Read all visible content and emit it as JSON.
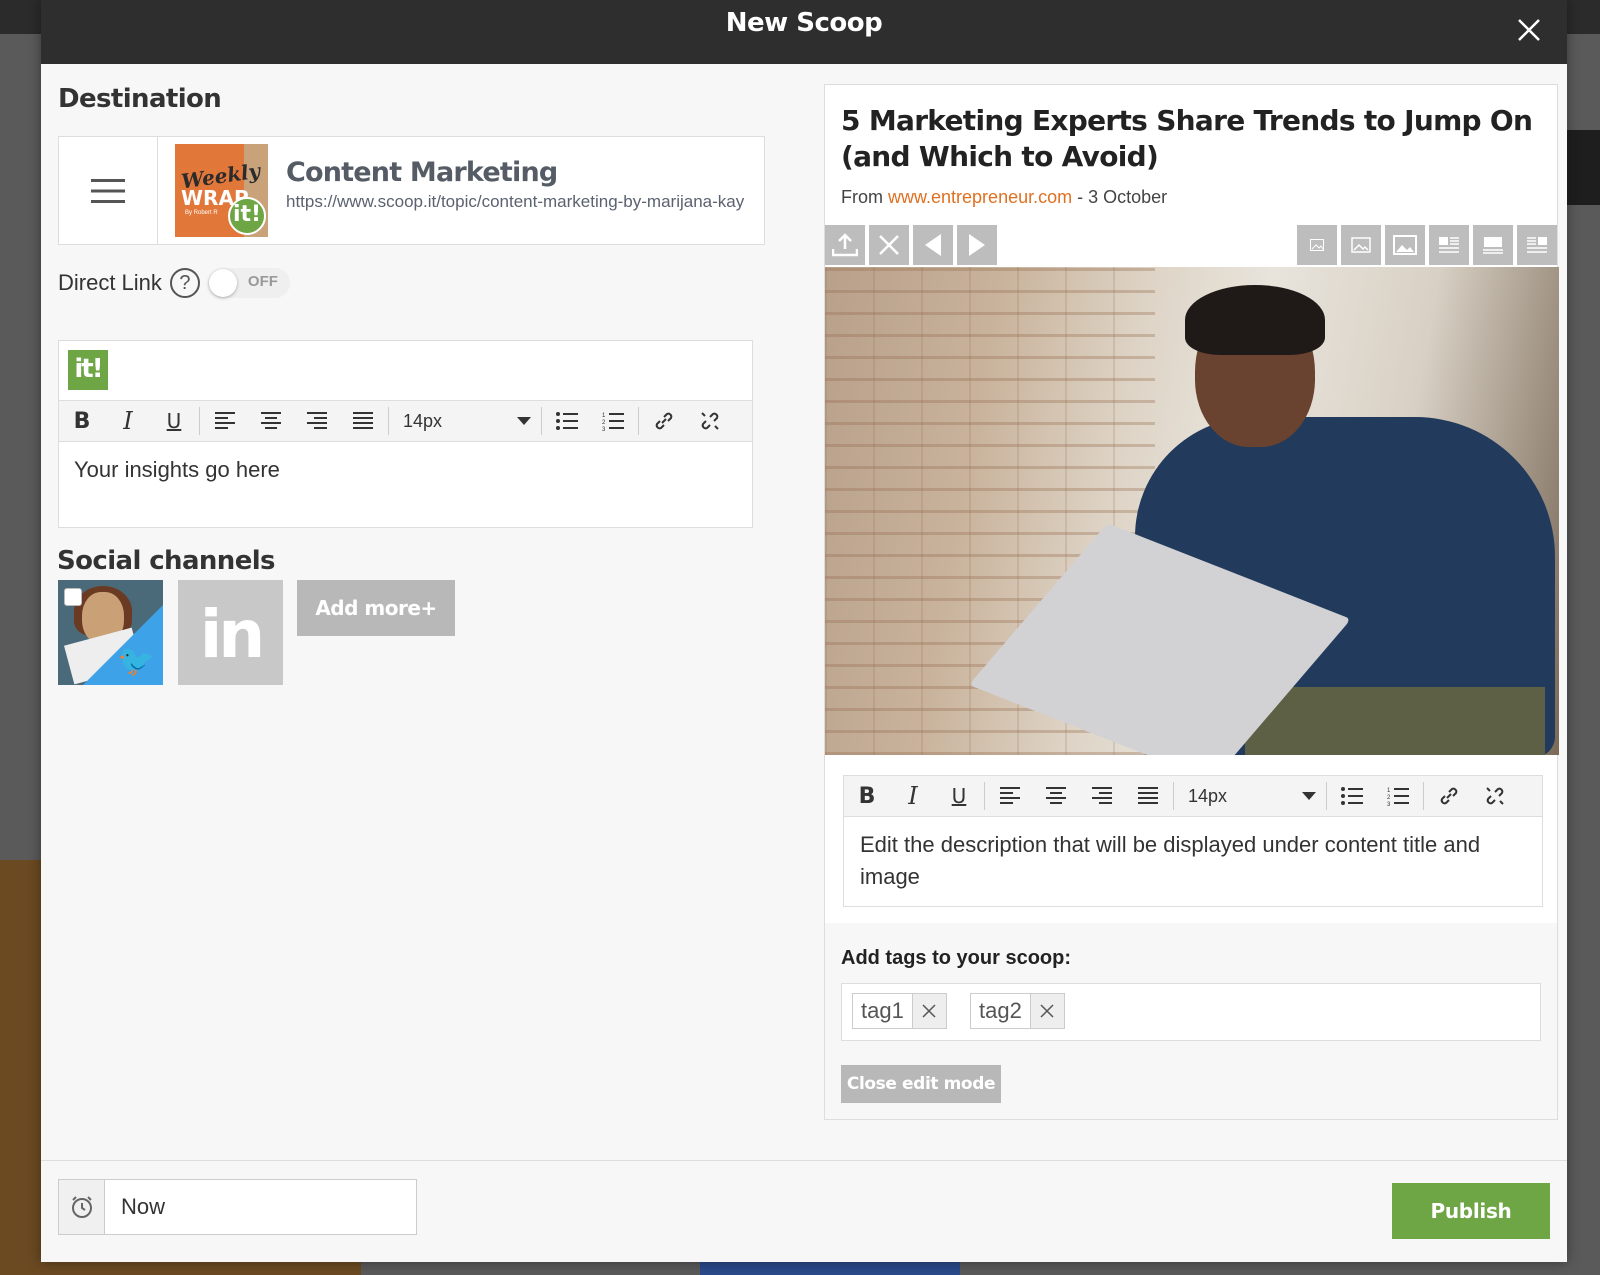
{
  "modal": {
    "title": "New Scoop"
  },
  "destination": {
    "heading": "Destination",
    "topic_name": "Content Marketing",
    "topic_url": "https://www.scoop.it/topic/content-marketing-by-marijana-kay",
    "thumb_line1": "Weekly",
    "thumb_line2": "WRAP",
    "thumb_line3": "By Robert R",
    "thumb_badge": "it!"
  },
  "direct_link": {
    "label": "Direct Link",
    "help": "?",
    "toggle_state": "OFF"
  },
  "insight_editor": {
    "logo": "it!",
    "font_size": "14px",
    "placeholder": "Your insights go here"
  },
  "social": {
    "heading": "Social channels",
    "add_more": "Add more+",
    "linkedin_mark": "in"
  },
  "preview": {
    "title": "5 Marketing Experts Share Trends to Jump On (and Which to Avoid)",
    "from_label": "From",
    "source": "www.entrepreneur.com",
    "date_sep": " - ",
    "date": "3 October",
    "font_size": "14px",
    "description": "Edit the description that will be displayed under content title and image",
    "tags_label": "Add tags to your scoop:",
    "tags": [
      "tag1",
      "tag2"
    ],
    "close_edit": "Close edit mode"
  },
  "footer": {
    "schedule_value": "Now",
    "publish": "Publish"
  },
  "colors": {
    "accent_green": "#6ea545",
    "link_orange": "#e07020",
    "header_dark": "#2e2e2e"
  }
}
